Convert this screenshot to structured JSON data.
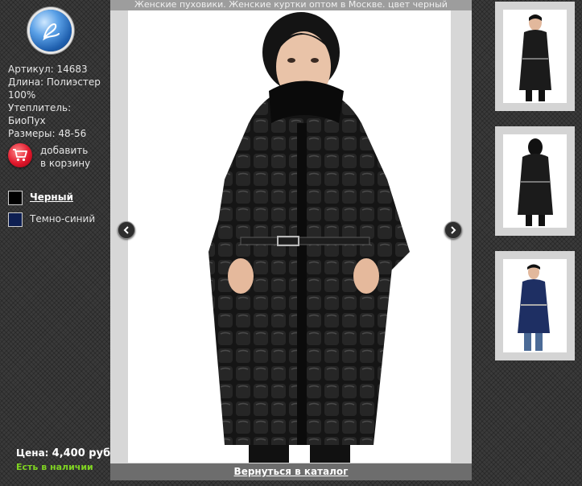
{
  "viewer": {
    "title": "Женские пуховики. Женские куртки оптом в Москве. цвет черный",
    "back_label": "Вернуться в каталог"
  },
  "product": {
    "article": "Артикул: 14683",
    "length_line1": "Длина: Полиэстер",
    "length_line2": "100%",
    "insulation_line1": "Утеплитель:",
    "insulation_line2": "БиоПух",
    "sizes": "Размеры: 48-56",
    "price_label": "Цена:",
    "price_value": "4,400 руб.",
    "stock": "Есть в наличии"
  },
  "cart": {
    "label_line1": "добавить",
    "label_line2": "в корзину"
  },
  "colors": [
    {
      "label": "Черный",
      "hex": "#000000",
      "active": true
    },
    {
      "label": "Темно-синий",
      "hex": "#0e1f52",
      "active": false
    }
  ],
  "thumbnails": [
    {
      "name": "thumb-black-front",
      "coat_color": "#1b1b1b"
    },
    {
      "name": "thumb-black-back",
      "coat_color": "#1b1b1b"
    },
    {
      "name": "thumb-navy-front",
      "coat_color": "#1e2f63"
    }
  ],
  "icons": {
    "logo": "logo-emblem-icon",
    "cart": "shopping-cart-icon",
    "prev": "chevron-left-icon",
    "next": "chevron-right-icon"
  }
}
